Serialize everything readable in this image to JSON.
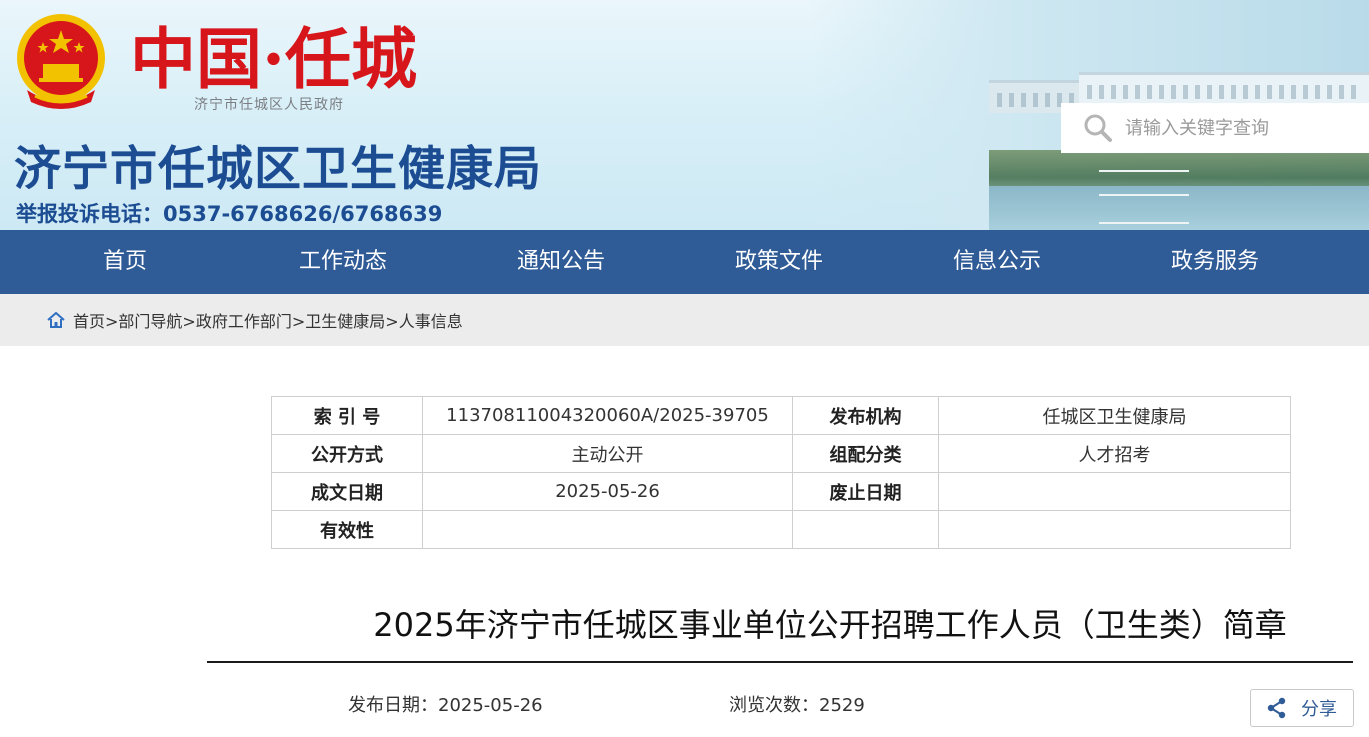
{
  "header": {
    "logo_text": "中国·任城",
    "gov_subtitle": "济宁市任城区人民政府",
    "site_title": "济宁市任城区卫生健康局",
    "hotline": "举报投诉电话：0537-6768626/6768639",
    "search_placeholder": "请输入关键字查询"
  },
  "nav": {
    "items": [
      "首页",
      "工作动态",
      "通知公告",
      "政策文件",
      "信息公示",
      "政务服务"
    ]
  },
  "breadcrumb": {
    "items": [
      "首页>",
      "部门导航>",
      "政府工作部门>",
      "卫生健康局>",
      "人事信息"
    ]
  },
  "meta_table": {
    "rows": [
      {
        "k1": "索 引 号",
        "v1": "11370811004320060A/2025-39705",
        "k2": "发布机构",
        "v2": "任城区卫生健康局"
      },
      {
        "k1": "公开方式",
        "v1": "主动公开",
        "k2": "组配分类",
        "v2": "人才招考"
      },
      {
        "k1": "成文日期",
        "v1": "2025-05-26",
        "k2": "废止日期",
        "v2": ""
      },
      {
        "k1": "有效性",
        "v1": "",
        "k2": "",
        "v2": ""
      }
    ]
  },
  "article": {
    "title": "2025年济宁市任城区事业单位公开招聘工作人员（卫生类）简章",
    "publish_date": "发布日期：2025-05-26",
    "views": "浏览次数：2529",
    "share_label": "分享"
  },
  "colors": {
    "nav_bg": "#2f5b96",
    "title_blue": "#1c4c92",
    "logo_red": "#d7161c"
  },
  "icons": [
    "national-emblem",
    "search-icon",
    "home-icon",
    "share-icon"
  ]
}
